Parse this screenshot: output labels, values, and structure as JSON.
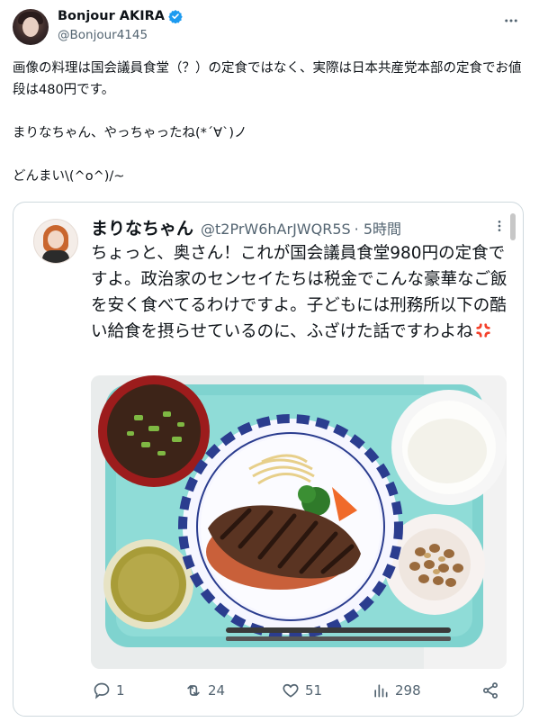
{
  "author": {
    "display_name": "Bonjour AKIRA",
    "handle": "@Bonjour4145"
  },
  "tweet": {
    "text": "画像の料理は国会議員食堂（？）の定食ではなく、実際は日本共産党本部の定食でお値段は480円です。\n\nまりなちゃん、やっちゃったね(*´∀`)ノ\n\nどんまい\\(^o^)/~"
  },
  "quote": {
    "display_name": "まりなちゃん",
    "handle": "@t2PrW6hArJWQR5S",
    "time": "· 5時間",
    "text": "ちょっと、奥さん！これが国会議員食堂980円の定食ですよ。政治家のセンセイたちは税金でこんな豪華なご飯を安く食べてるわけですよ。子どもには刑務所以下の酷い給食を摂らせているのに、ふざけた話ですわよね",
    "emoji_icon": "anger-symbol-icon",
    "photo_alt_icon": "set-meal-photo"
  },
  "actions": {
    "replies": "1",
    "retweets": "24",
    "likes": "51",
    "views": "298"
  },
  "colors": {
    "verified": "#1d9bf0",
    "secondary_text": "#536471",
    "border": "#cfd9de",
    "anger": "#f4402a"
  }
}
